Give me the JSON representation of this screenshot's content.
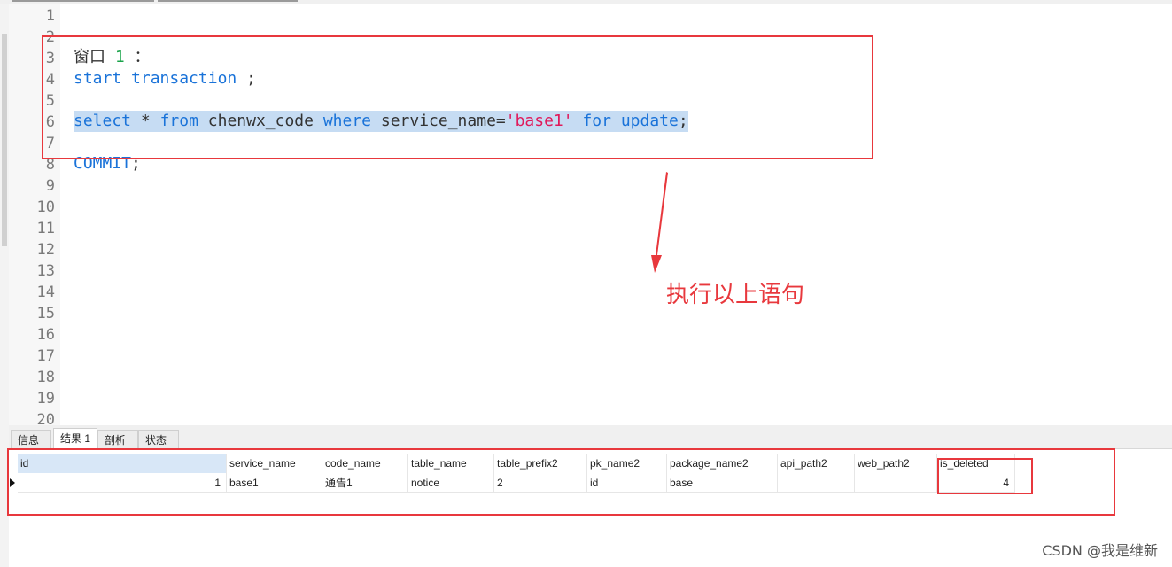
{
  "editor": {
    "line_numbers": [
      "1",
      "2",
      "3",
      "4",
      "5",
      "6",
      "7",
      "8",
      "9",
      "10",
      "11",
      "12",
      "13",
      "14",
      "15",
      "16",
      "17",
      "18",
      "19",
      "20"
    ],
    "line3": {
      "text": "窗口",
      "num": "1",
      "colon": "："
    },
    "line4": {
      "kw1": "start",
      "kw2": "transaction",
      "semi": ";"
    },
    "line6": {
      "kw_select": "select",
      "star": "*",
      "kw_from": "from",
      "table": "chenwx_code",
      "kw_where": "where",
      "col": "service_name=",
      "str": "'base1'",
      "kw_for": "for",
      "kw_update": "update",
      "semi": ";"
    },
    "line8": {
      "kw": "COMMIT",
      "semi": ";"
    }
  },
  "annotation": {
    "text": "执行以上语句",
    "color": "#e8383d"
  },
  "results": {
    "tabs": [
      "信息",
      "结果 1",
      "剖析",
      "状态"
    ],
    "active_tab": "结果 1",
    "columns": [
      "id",
      "service_name",
      "code_name",
      "table_name",
      "table_prefix2",
      "pk_name2",
      "package_name2",
      "api_path2",
      "web_path2",
      "is_deleted"
    ],
    "row": [
      "1",
      "base1",
      "通告1",
      "notice",
      "2",
      "id",
      "base",
      "",
      "",
      "4"
    ]
  },
  "watermark": "CSDN @我是维新"
}
